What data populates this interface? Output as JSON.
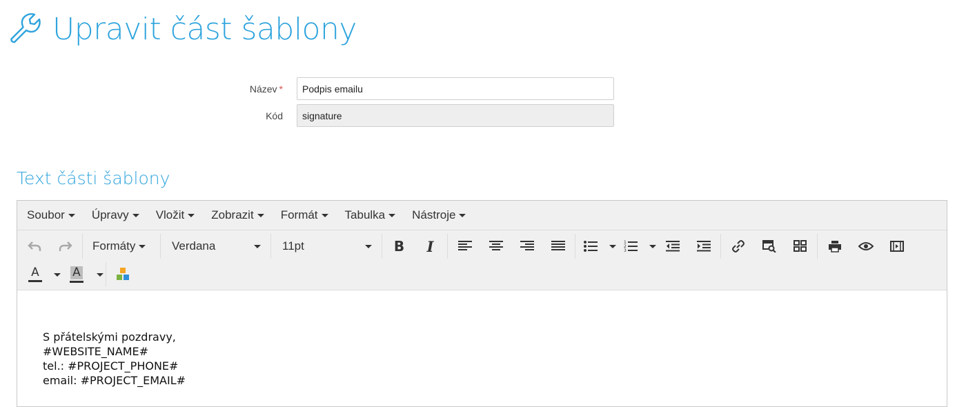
{
  "header": {
    "title": "Upravit část šablony",
    "icon": "wrench-icon"
  },
  "form": {
    "name_label": "Název",
    "required_mark": "*",
    "name_value": "Podpis emailu",
    "code_label": "Kód",
    "code_value": "signature"
  },
  "section": {
    "title": "Text části šablony"
  },
  "editor": {
    "menu": [
      "Soubor",
      "Úpravy",
      "Vložit",
      "Zobrazit",
      "Formát",
      "Tabulka",
      "Nástroje"
    ],
    "formats_label": "Formáty",
    "font_family": "Verdana",
    "font_size": "11pt",
    "toolbar_icons": [
      "undo-icon",
      "redo-icon",
      "bold-icon",
      "italic-icon",
      "align-left-icon",
      "align-center-icon",
      "align-right-icon",
      "align-justify-icon",
      "bullet-list-icon",
      "numbered-list-icon",
      "outdent-icon",
      "indent-icon",
      "link-icon",
      "search-image-icon",
      "template-icon",
      "print-icon",
      "preview-icon",
      "media-icon",
      "text-color-icon",
      "background-color-icon",
      "blocks-icon"
    ],
    "text_color_letter": "A",
    "bg_color_letter": "A",
    "content_lines": [
      "S přátelskými pozdravy,",
      "#WEBSITE_NAME#",
      "tel.: #PROJECT_PHONE#",
      "email: #PROJECT_EMAIL#"
    ]
  },
  "colors": {
    "accent": "#2fa4dd",
    "required": "#d9534f",
    "toolbar_bg": "#f0f0f0"
  }
}
